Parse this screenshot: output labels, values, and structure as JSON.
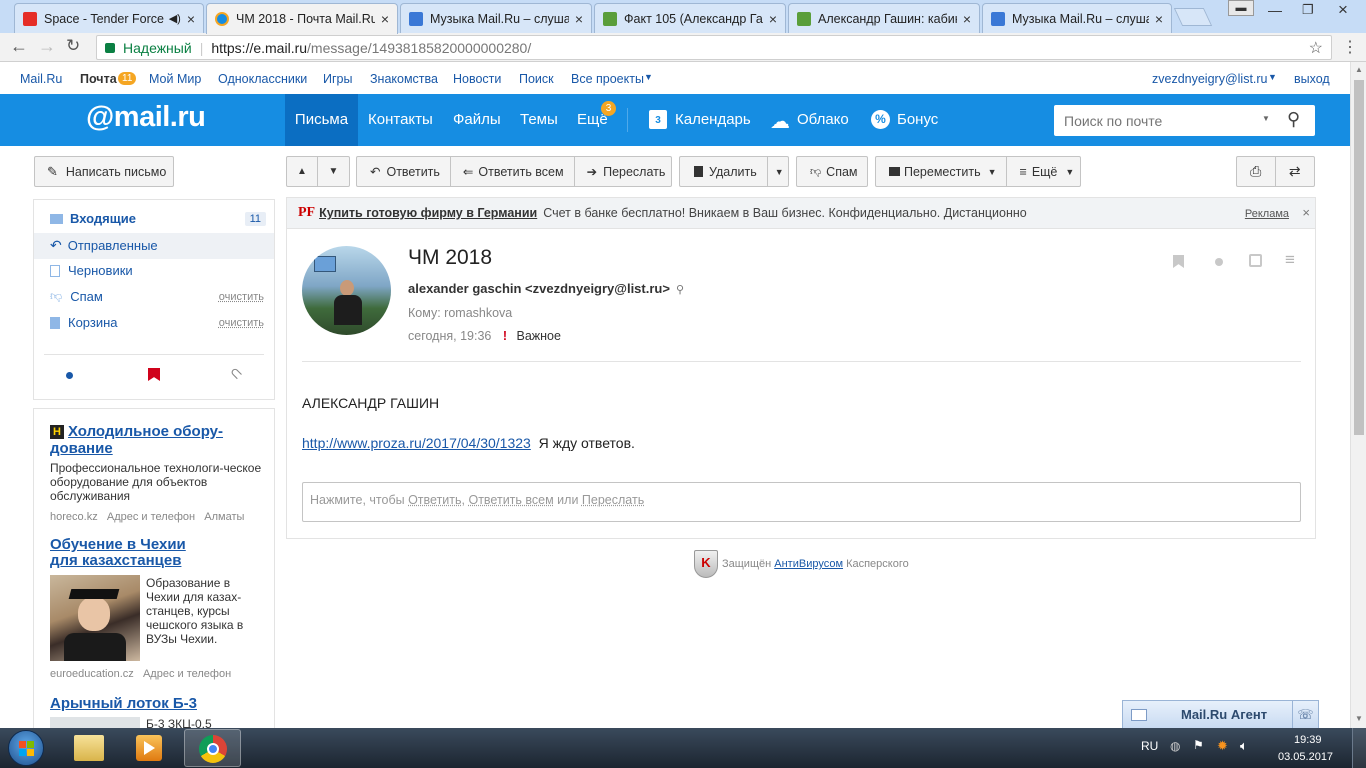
{
  "tabs": [
    {
      "title": "Space - Tender Force",
      "active": false,
      "icon": "youtube-icon"
    },
    {
      "title": "ЧМ 2018 - Почта Mail.Ru",
      "active": true,
      "icon": "mail-icon"
    },
    {
      "title": "Музыка Mail.Ru – слуша",
      "active": false,
      "icon": "music-icon"
    },
    {
      "title": "Факт 105 (Александр Га",
      "active": false,
      "icon": "proza-icon"
    },
    {
      "title": "Александр Гашин: кабин",
      "active": false,
      "icon": "proza-icon"
    },
    {
      "title": "Музыка Mail.Ru – слуша",
      "active": false,
      "icon": "music-icon"
    }
  ],
  "address": {
    "secure_label": "Надежный",
    "url_host": "https://e.mail.ru",
    "url_path": "/message/14938185820000000280/"
  },
  "portal": {
    "links": [
      "Mail.Ru",
      "Почта",
      "Мой Мир",
      "Одноклассники",
      "Игры",
      "Знакомства",
      "Новости",
      "Поиск",
      "Все проекты"
    ],
    "mail_badge": "11",
    "account": "zvezdnyeigry@list.ru",
    "logout": "выход"
  },
  "header": {
    "logo": "@mail.ru",
    "nav": [
      "Письма",
      "Контакты",
      "Файлы",
      "Темы",
      "Ещё"
    ],
    "more_badge": "3",
    "calendar_day": "3",
    "calendar": "Календарь",
    "cloud": "Облако",
    "bonus": "Бонус",
    "search_placeholder": "Поиск по почте"
  },
  "compose_label": "Написать письмо",
  "folders": [
    {
      "name": "Входящие",
      "count": "11"
    },
    {
      "name": "Отправленные"
    },
    {
      "name": "Черновики"
    },
    {
      "name": "Спам",
      "action": "очистить"
    },
    {
      "name": "Корзина",
      "action": "очистить"
    }
  ],
  "toolbar": {
    "reply": "Ответить",
    "reply_all": "Ответить всем",
    "forward": "Переслать",
    "delete": "Удалить",
    "spam": "Спам",
    "move": "Переместить",
    "more": "Ещё"
  },
  "banner": {
    "badge": "PF",
    "link": "Купить готовую фирму в Германии",
    "text": "Счет в банке бесплатно! Вникаем в Ваш бизнес. Конфиденциально. Дистанционно",
    "ad_label": "Реклама"
  },
  "message": {
    "subject": "ЧМ 2018",
    "from": "alexander gaschin <zvezdnyeigry@list.ru>",
    "to": "Кому: romashkova",
    "date": "сегодня, 19:36",
    "important_mark": "!",
    "important": "Важное",
    "body_heading": "АЛЕКСАНДР ГАШИН",
    "link": "http://www.proza.ru/2017/04/30/1323",
    "body_text": "Я жду ответов.",
    "quick_reply": {
      "prefix": "Нажмите, чтобы",
      "reply": "Ответить",
      "sep1": ",",
      "reply_all": "Ответить всем",
      "or": "или",
      "forward": "Переслать"
    }
  },
  "kaspersky": {
    "prefix": "Защищён",
    "link": "АнтиВирусом",
    "suffix": "Касперского"
  },
  "ads": [
    {
      "badge": "H",
      "title": "Холодильное обору-дование",
      "text": "Профессиональное технологи-ческое оборудование для объектов обслуживания",
      "site": "horeco.kz",
      "addr": "Адрес и телефон",
      "city": "Алматы"
    },
    {
      "title": "Обучение в Чехии для казахстанцев",
      "text": "Образование в Чехии для казах-станцев, курсы чешского языка в ВУЗы Чехии.",
      "site": "euroeducation.cz",
      "addr": "Адрес и телефон"
    },
    {
      "title": "Арычный лоток Б-3",
      "text": "Б-3 ЗКЦ-0,5"
    }
  ],
  "agent": {
    "label": "Mail.Ru Агент"
  },
  "taskbar": {
    "lang": "RU",
    "time": "19:39",
    "date": "03.05.2017"
  },
  "colors": {
    "brand_blue": "#168de2",
    "header_active": "#0b6ec2",
    "link": "#1958a8",
    "badge_orange": "#f5a623"
  }
}
